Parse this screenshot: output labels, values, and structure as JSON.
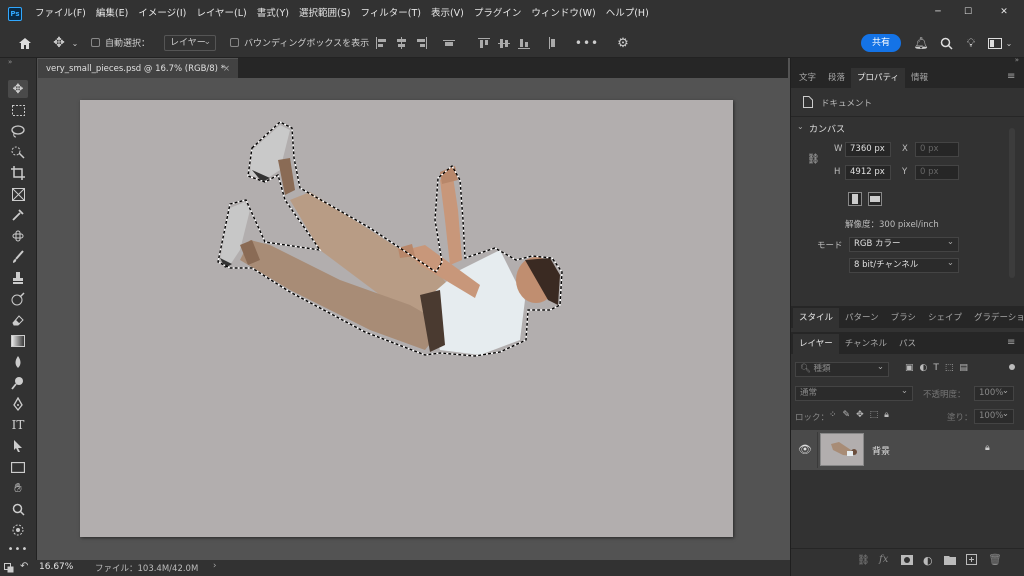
{
  "app": {
    "logo": "Ps"
  },
  "menu": [
    "ファイル(F)",
    "編集(E)",
    "イメージ(I)",
    "レイヤー(L)",
    "書式(Y)",
    "選択範囲(S)",
    "フィルター(T)",
    "表示(V)",
    "プラグイン",
    "ウィンドウ(W)",
    "ヘルプ(H)"
  ],
  "options": {
    "auto_select_label": "自動選択：",
    "auto_select_target": "レイヤー",
    "bounding_box_label": "バウンディングボックスを表示",
    "share": "共有"
  },
  "document": {
    "tab_title": "very_small_pieces.psd @ 16.7% (RGB/8) *",
    "tab_close": "×"
  },
  "status": {
    "zoom": "16.67%",
    "file_info": "ファイル：103.4M/42.0M",
    "arrow": "›"
  },
  "properties": {
    "tabs": [
      "文字",
      "段落",
      "プロパティ",
      "情報"
    ],
    "active_tab": "プロパティ",
    "doc_label": "ドキュメント",
    "canvas_label": "カンバス",
    "w_label": "W",
    "w_value": "7360 px",
    "h_label": "H",
    "h_value": "4912 px",
    "x_label": "X",
    "x_value": "0 px",
    "y_label": "Y",
    "y_value": "0 px",
    "resolution": "解像度：300 pixel/inch",
    "mode_label": "モード",
    "mode_value": "RGB カラー",
    "depth_value": "8 bit/チャンネル"
  },
  "styles_tabs": [
    "スタイル",
    "パターン",
    "ブラシ",
    "シェイプ",
    "グラデーション"
  ],
  "layers_panel": {
    "tabs": [
      "レイヤー",
      "チャンネル",
      "パス"
    ],
    "kind_placeholder": "種類",
    "blend_mode": "通常",
    "opacity_label": "不透明度：",
    "opacity_value": "100%",
    "lock_label": "ロック：",
    "fill_label": "塗り：",
    "fill_value": "100%",
    "layers": [
      {
        "name": "背景",
        "visible": true,
        "locked": true
      }
    ]
  },
  "colors": {
    "accent": "#1473e6",
    "canvas": "#b2aeae",
    "panel": "#323232"
  }
}
